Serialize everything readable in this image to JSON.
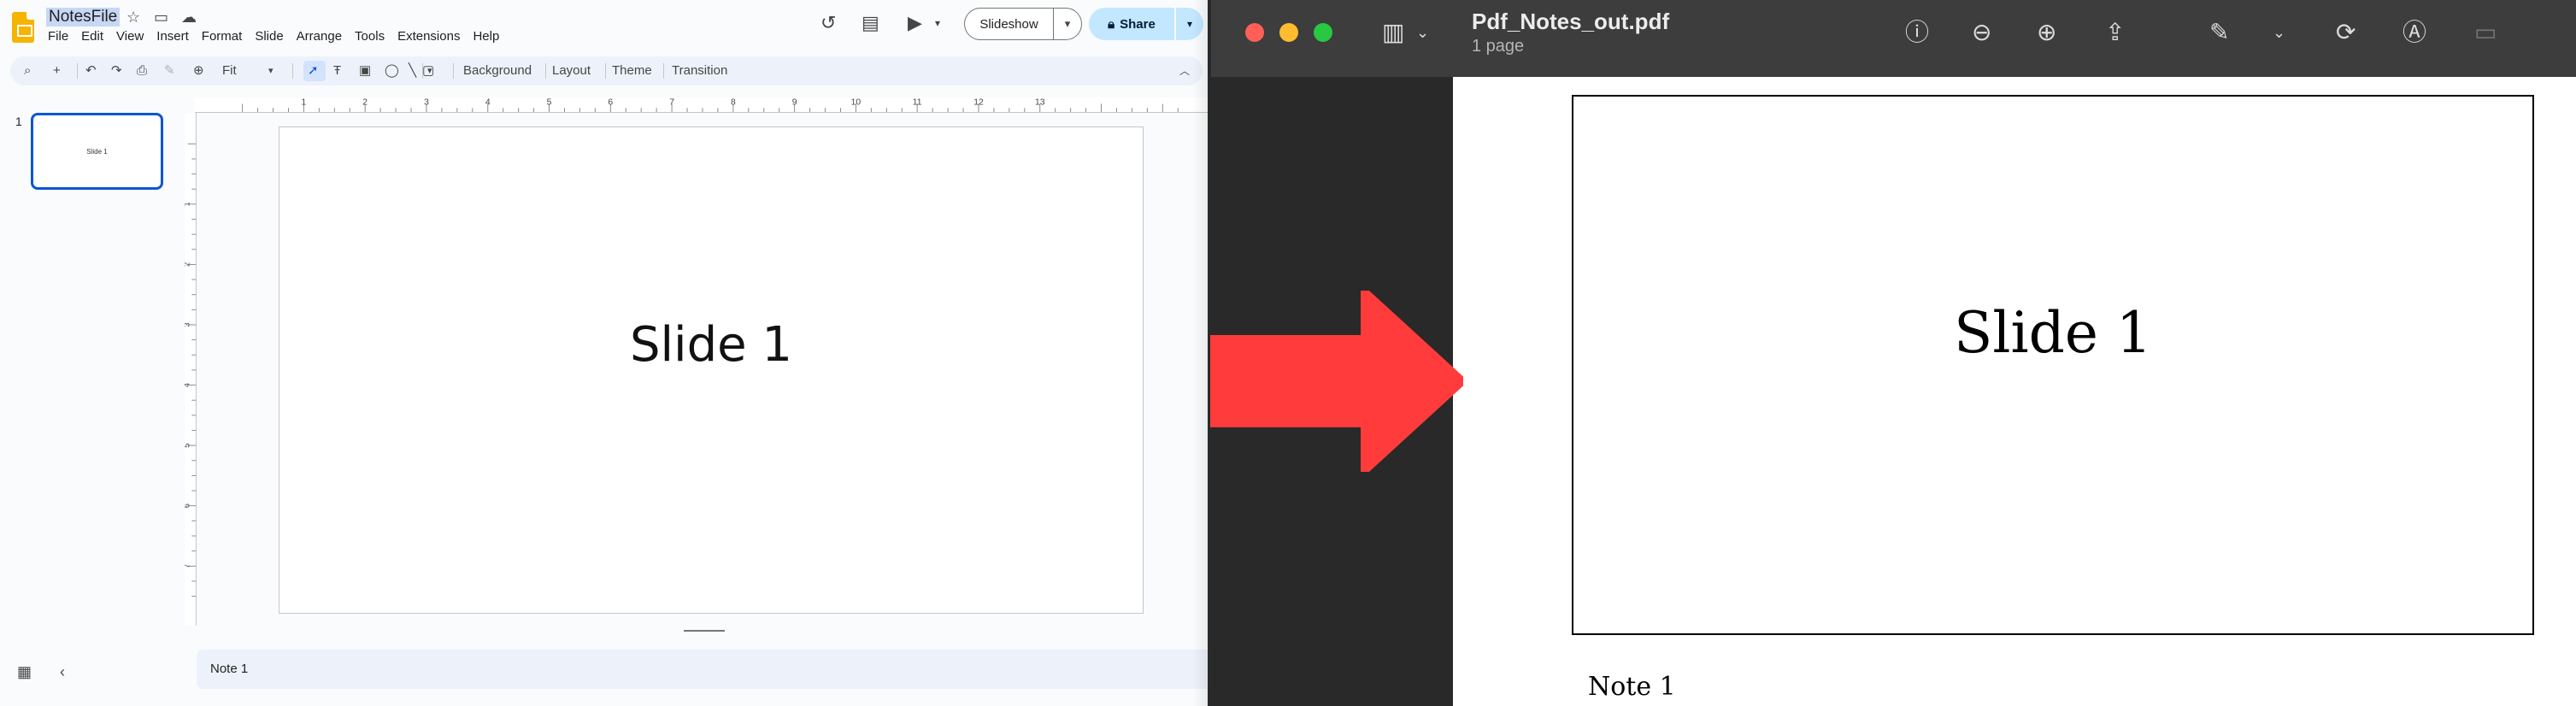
{
  "slides_app": {
    "doc_title": "NotesFile",
    "menu": [
      "File",
      "Edit",
      "View",
      "Insert",
      "Format",
      "Slide",
      "Arrange",
      "Tools",
      "Extensions",
      "Help"
    ],
    "slideshow_label": "Slideshow",
    "share_label": "Share",
    "toolbar": {
      "zoom": "Fit",
      "background_label": "Background",
      "layout_label": "Layout",
      "theme_label": "Theme",
      "transition_label": "Transition"
    },
    "filmstrip": [
      {
        "number": "1",
        "thumb_text": "Slide 1"
      }
    ],
    "ruler_h": [
      "1",
      "2",
      "3",
      "4",
      "5",
      "6",
      "7",
      "8",
      "9",
      "10",
      "11",
      "12",
      "13"
    ],
    "ruler_v": [
      "1",
      "2",
      "3",
      "4",
      "5",
      "6",
      "7"
    ],
    "slide_title": "Slide 1",
    "notes": "Note 1"
  },
  "preview_app": {
    "file_name": "Pdf_Notes_out.pdf",
    "page_count": "1 page",
    "slide_title": "Slide 1",
    "note": "Note 1"
  },
  "colors": {
    "arrow": "#ff3b3b",
    "share_bg": "#c2e7ff",
    "accent_blue": "#0b57d0",
    "traffic_red": "#ff5f57",
    "traffic_yellow": "#febc2e",
    "traffic_green": "#28c840"
  }
}
